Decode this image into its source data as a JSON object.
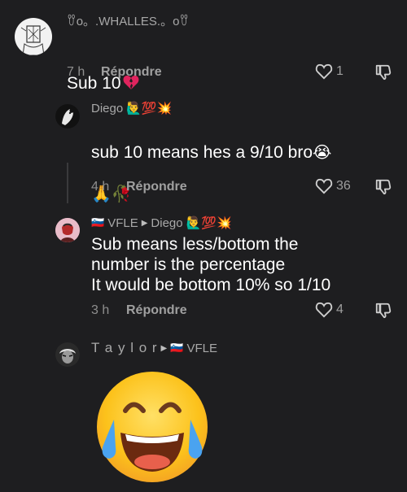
{
  "comments": [
    {
      "username": "ꀎo。.WHALLES.。oꀎ",
      "text": "Sub 10",
      "time": "7 h",
      "reply": "Répondre",
      "likes": "1"
    },
    {
      "username": "Diego",
      "username_emojis": "🙋‍♂️💯💥",
      "text": "sub 10 means hes a 9/10 bro",
      "text_emoji_1": "😭",
      "text_emoji_2": "🙏🥀",
      "time": "4 h",
      "reply": "Répondre",
      "likes": "36"
    },
    {
      "username": "VFLE",
      "flag": "🇸🇮",
      "reply_to": "Diego",
      "reply_to_emojis": "🙋‍♂️💯💥",
      "text": "Sub means less/bottom the\nnumber is the percentage\nIt would be bottom 10% so 1/10",
      "time": "3 h",
      "reply": "Répondre",
      "likes": "4"
    },
    {
      "username": "T a y l o r",
      "flag": "🇸🇮",
      "reply_to": "VFLE",
      "big_emoji": "😂"
    }
  ],
  "colors": {
    "background": "#1e1e20",
    "heartbreak": "#e0245e",
    "text": "#ffffff",
    "muted": "#8e8e8e"
  }
}
